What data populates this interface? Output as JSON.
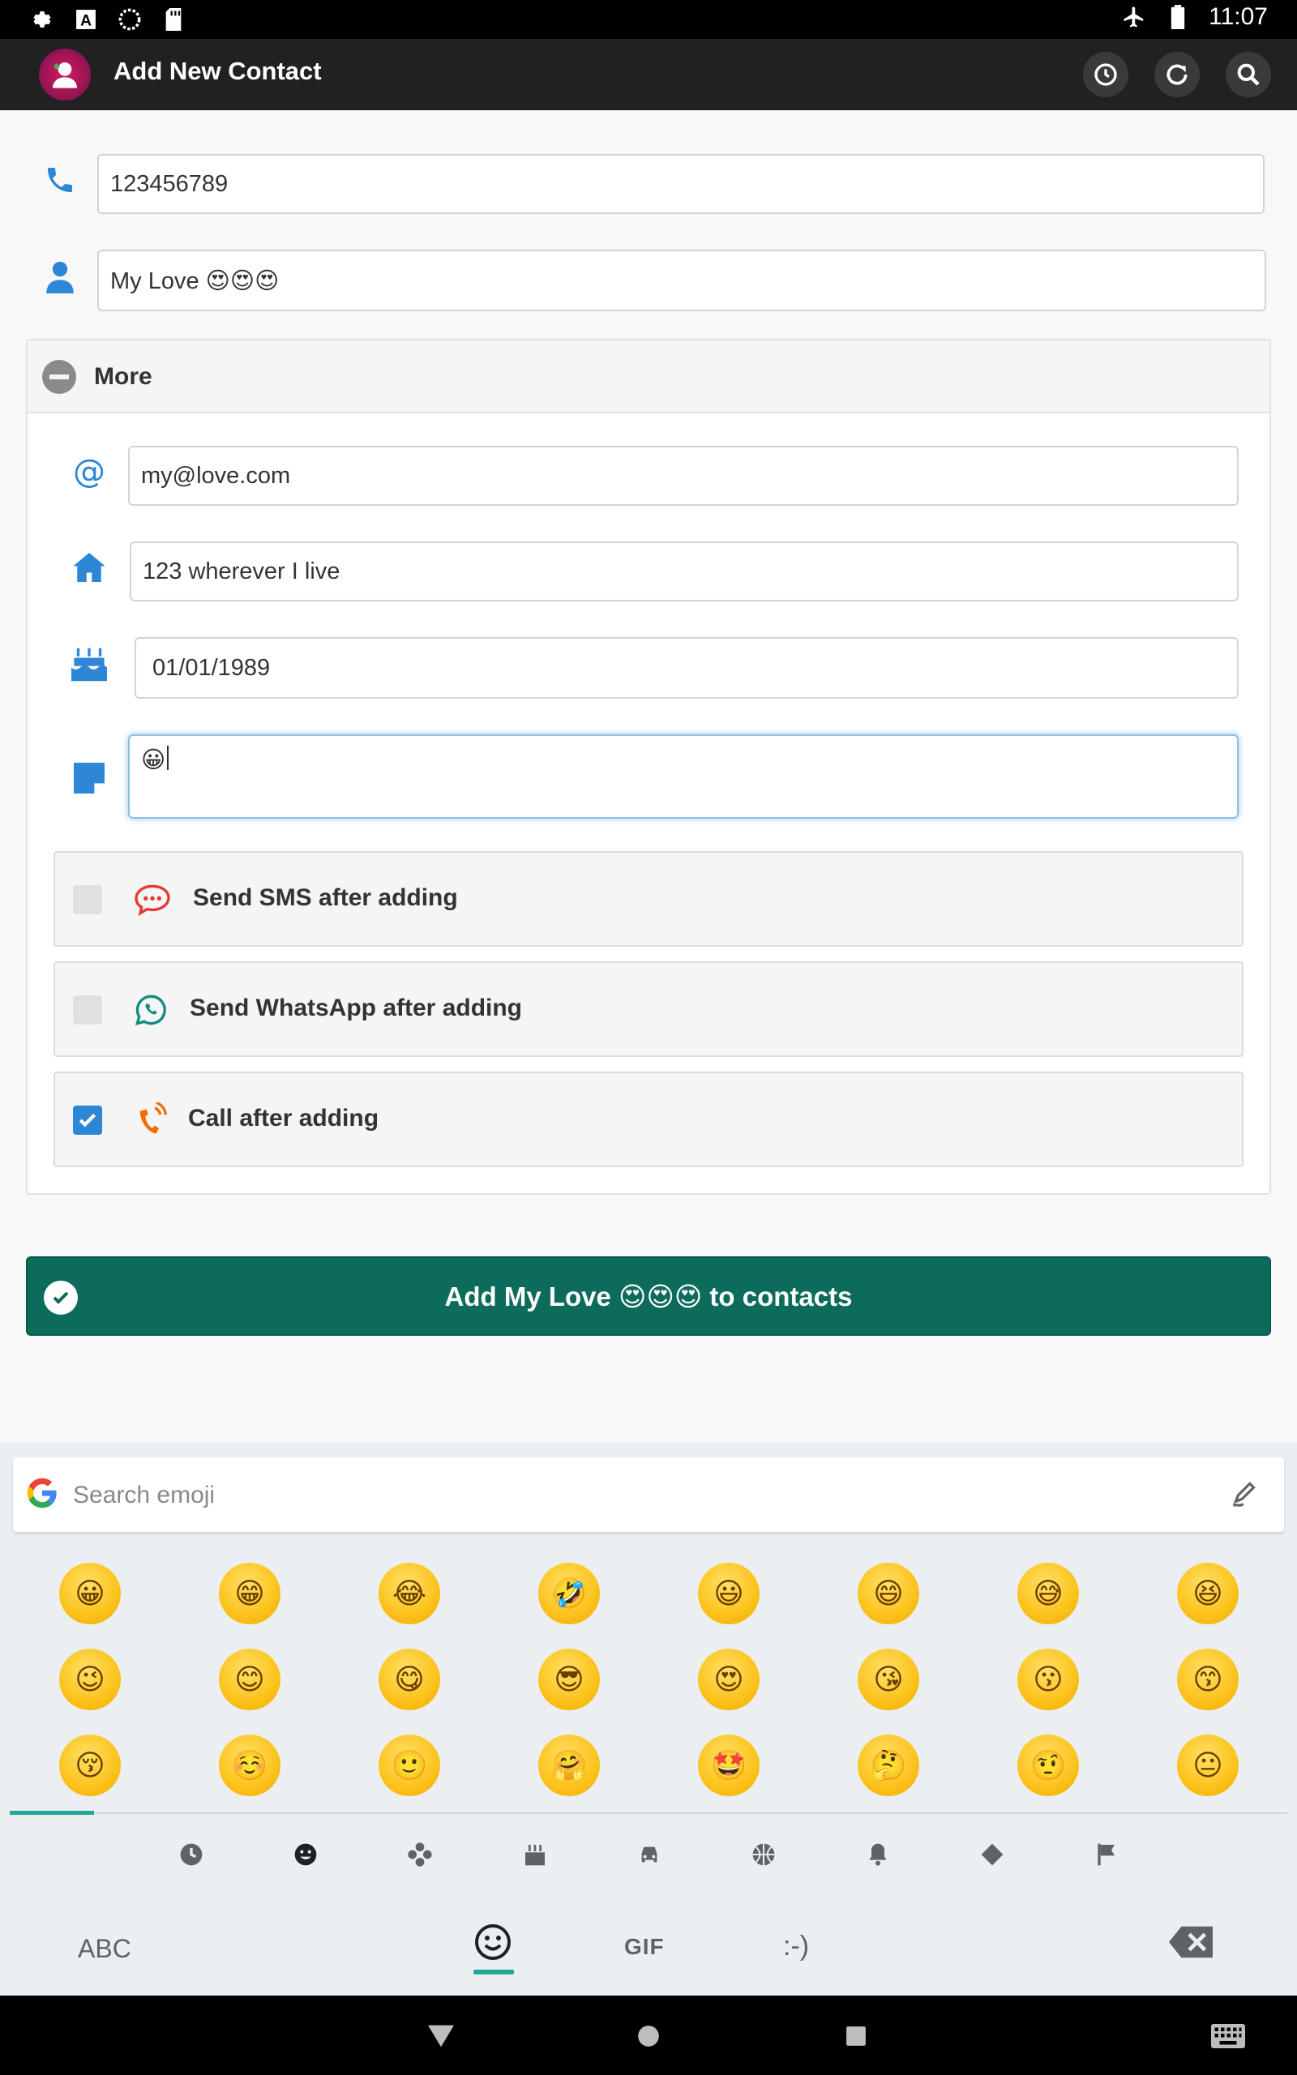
{
  "status_bar": {
    "time": "11:07",
    "icons_left": [
      "gear-icon",
      "font-a-icon",
      "sync-circle-icon",
      "sd-card-icon"
    ],
    "icons_right": [
      "airplane-icon",
      "battery-icon"
    ]
  },
  "app_bar": {
    "title": "Add New Contact",
    "actions": [
      "history-icon",
      "refresh-icon",
      "search-icon"
    ]
  },
  "form": {
    "phone_value": "123456789",
    "name_value": "My Love 😍😍😍",
    "more_label": "More",
    "email_value": "my@love.com",
    "address_value": "123 wherever I live",
    "birthday_value": "01/01/1989",
    "note_value": "😀"
  },
  "options": [
    {
      "label": "Send SMS after adding",
      "checked": false,
      "icon": "sms-bubble-icon",
      "color": "#e53935"
    },
    {
      "label": "Send WhatsApp after adding",
      "checked": false,
      "icon": "whatsapp-icon",
      "color": "#128c7e"
    },
    {
      "label": "Call after adding",
      "checked": true,
      "icon": "phone-ringing-icon",
      "color": "#ef6c00"
    }
  ],
  "add_button": {
    "label": "Add My Love 😍😍😍 to contacts",
    "color": "#0d6b5b"
  },
  "keyboard": {
    "search_placeholder": "Search emoji",
    "emojis": [
      "😀",
      "😁",
      "😂",
      "🤣",
      "😃",
      "😄",
      "😅",
      "😆",
      "😉",
      "😊",
      "😋",
      "😎",
      "😍",
      "😘",
      "😗",
      "😙",
      "😚",
      "☺️",
      "🙂",
      "🤗",
      "🤩",
      "🤔",
      "🤨",
      "😐"
    ],
    "categories": [
      "recent-clock-icon",
      "smiley-icon",
      "nature-flower-icon",
      "food-cake-icon",
      "car-icon",
      "ball-icon",
      "bell-icon",
      "diamond-icon",
      "flag-icon"
    ],
    "abc_label": "ABC",
    "gif_label": "GIF",
    "emoticon_label": ":-)",
    "accent": "#26a69a"
  }
}
